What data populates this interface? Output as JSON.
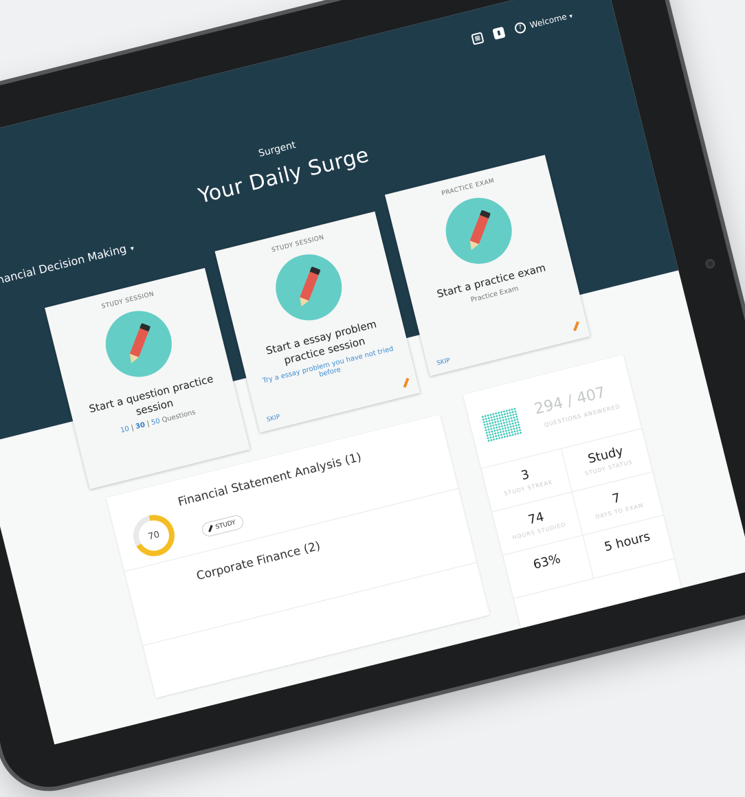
{
  "header": {
    "brand": "Surgent",
    "welcome": "Welcome",
    "caret": "▾",
    "course": "Financial Decision Making",
    "headline": "Your Daily Surge",
    "icons": [
      "calendar-icon",
      "book-icon",
      "help-icon"
    ]
  },
  "cards": [
    {
      "kicker": "STUDY SESSION",
      "title": "Start a question practice session",
      "options": [
        "10",
        "30",
        "50"
      ],
      "separator": "|",
      "options_suffix": "Questions"
    },
    {
      "kicker": "STUDY SESSION",
      "title": "Start a essay problem practice session",
      "subtitle": "Try a essay problem you have not tried before",
      "skip": "SKIP"
    },
    {
      "kicker": "PRACTICE EXAM",
      "title": "Start a practice exam",
      "subtitle": "Practice Exam",
      "skip": "SKIP"
    }
  ],
  "topics": [
    {
      "name": "Financial Statement Analysis (1)",
      "score": "70",
      "progress": 0.7,
      "button": "STUDY"
    },
    {
      "name": "Corporate Finance (2)"
    }
  ],
  "stats": {
    "questions_answered": "294 / 407",
    "questions_label": "QUESTIONS ANSWERED",
    "cells": [
      {
        "value": "3",
        "label": "STUDY STREAK"
      },
      {
        "value": "Study",
        "label": "STUDY STATUS"
      },
      {
        "value": "74",
        "label": "HOURS STUDIED"
      },
      {
        "value": "7",
        "label": "DAYS TO EXAM"
      },
      {
        "value": "63%",
        "label": ""
      },
      {
        "value": "5 hours",
        "label": ""
      }
    ]
  },
  "colors": {
    "hero": "#1f3c4b",
    "teal": "#64cdc6",
    "accent_blue": "#3f8fd2",
    "ring": "#f5bd24"
  }
}
